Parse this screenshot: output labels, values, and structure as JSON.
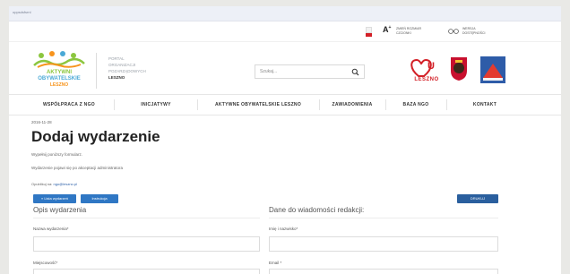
{
  "top_strip": {
    "text": "oppsdsfsrnl"
  },
  "util_bar": {
    "zoom_label": "A",
    "zoom_sup": "+",
    "contrast_lines": [
      "ZMIEŃ ROZMIAR",
      "CZCIONKI"
    ],
    "access_lines": [
      "WERSJA",
      "DOSTĘPNOŚCI"
    ]
  },
  "header": {
    "logo_lines": [
      "AKTYWNI",
      "OBYWATELSKIE",
      "LESZNO"
    ],
    "portal_lines": [
      "PORTAL",
      "ORGANIZACJI",
      "POZARZĄDOWYCH",
      "LESZNO"
    ],
    "search_placeholder": "Szukaj...",
    "leszno_logo_text": "LESZNO"
  },
  "nav": {
    "items": [
      "WSPÓŁPRACA Z NGO",
      "INICJATYWY",
      "AKTYWNE OBYWATELSKIE LESZNO",
      "ZAWIADOMIENIA",
      "BAZA NGO",
      "KONTAKT"
    ]
  },
  "page": {
    "date": "2016-11-28",
    "title": "Dodaj wydarzenie",
    "instruction": "Wypełnij poniższy formularz.",
    "notice": "Wydarzenie pojawi się po akceptacji administratora",
    "contact_prefix": "Opublikuj na:",
    "contact_email": "ngo@leszno.pl",
    "btn_back": "« Lista wydarzeń",
    "btn_instructions": "Instrukcja",
    "btn_print": "DRUKUJ",
    "section_left": "Opis wydarzenia",
    "section_right": "Dane do wiadomości redakcji:",
    "field_event_name": "Nazwa wydarzenia*",
    "field_name_surname": "Imię i nazwisko*",
    "field_location": "Miejscowość*",
    "field_email": "Email *"
  },
  "colors": {
    "accent_blue": "#2f77c4",
    "flag_red": "#d32027"
  }
}
